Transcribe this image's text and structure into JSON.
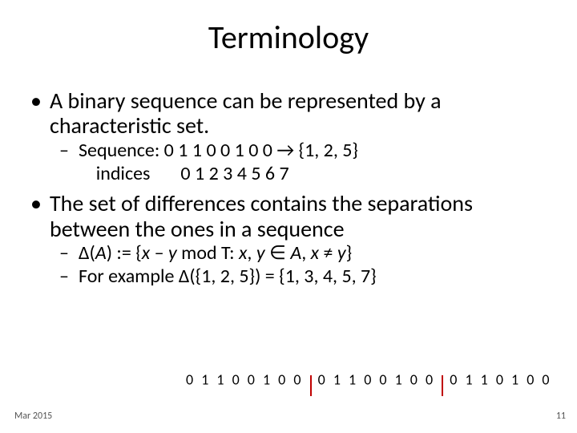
{
  "title": "Terminology",
  "bullets": {
    "p1": "A binary sequence can be represented by a characteristic set.",
    "p1s1": "Sequence:  0 1 1 0 0 1 0 0 → {1, 2, 5}",
    "p1s2": "    indices       0 1 2 3 4 5 6 7",
    "p2": "The set of differences contains the separations between the ones in a sequence",
    "p2s1a": "Δ(",
    "p2s1b": ") := {",
    "p2s1c": " – ",
    "p2s1d": " mod T: ",
    "p2s1e": ", ",
    "p2s1f": " ∈ ",
    "p2s1g": ", ",
    "p2s1h": " ≠ ",
    "p2s1i": "}",
    "varA": "A",
    "varx": "x",
    "vary": "y",
    "p2s2": "For example Δ({1, 2, 5}) = {1, 3, 4, 5, 7}"
  },
  "seq": {
    "g1": "0 1 1 0 0 1 0 0",
    "g2": "0 1 1 0 0 1 0 0",
    "g3": "0 1 1 0 1 0 0"
  },
  "footer": {
    "date": "Mar 2015",
    "page": "11"
  }
}
